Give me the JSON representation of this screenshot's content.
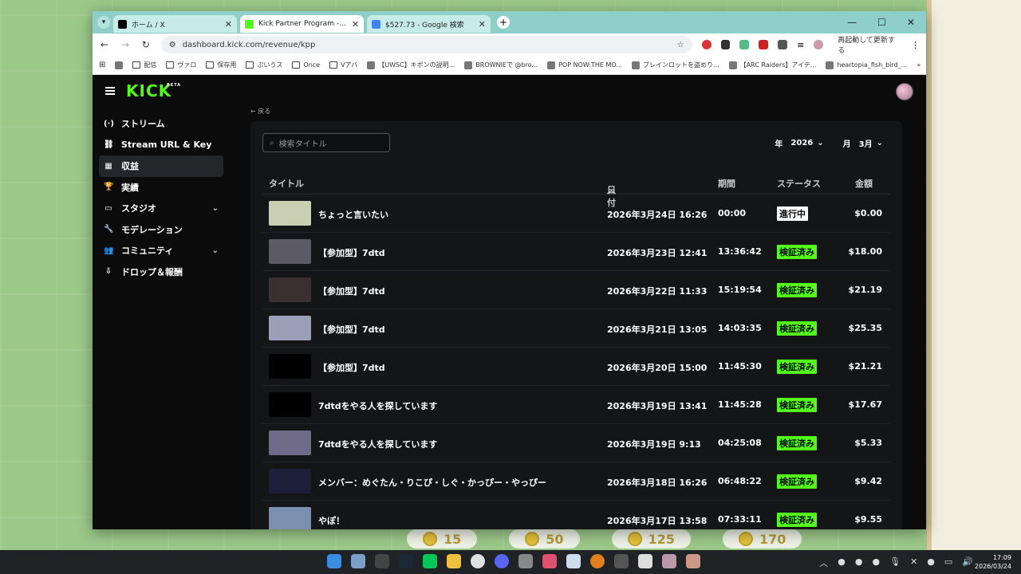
{
  "browser": {
    "tabs": [
      {
        "label": "ホーム / X",
        "favicon_color": "#000000",
        "active": false
      },
      {
        "label": "Kick Partner Program - Kick Da",
        "favicon_color": "#53fc18",
        "active": true
      },
      {
        "label": "$527.73 - Google 検索",
        "favicon_color": "#4285f4",
        "active": false
      }
    ],
    "url": "dashboard.kick.com/revenue/kpp",
    "relaunch_label": "再起動して更新する",
    "bookmarks": [
      {
        "label": "",
        "type": "app"
      },
      {
        "label": "",
        "type": "fav"
      },
      {
        "label": "配信",
        "type": "folder"
      },
      {
        "label": "ヴァロ",
        "type": "folder"
      },
      {
        "label": "保存用",
        "type": "folder"
      },
      {
        "label": "ぷいうス",
        "type": "folder"
      },
      {
        "label": "Once",
        "type": "folder"
      },
      {
        "label": "Vアバ",
        "type": "folder"
      },
      {
        "label": "【UWSC】キボンの説明...",
        "type": "fav"
      },
      {
        "label": "BROWNIEで @bro...",
        "type": "fav"
      },
      {
        "label": "POP NOW:THE MO...",
        "type": "fav"
      },
      {
        "label": "ブレインロットを盗めり...",
        "type": "fav"
      },
      {
        "label": "【ARC Raiders】アイテ...",
        "type": "fav"
      },
      {
        "label": "heartopia_fish_bird_...",
        "type": "fav"
      }
    ]
  },
  "kick": {
    "logo": "KICK",
    "logo_badge": "BETA",
    "breadcrumb": "← 戻る",
    "sidebar": [
      {
        "label": "ストリーム",
        "icon": "broadcast-icon",
        "glyph": "(·)",
        "active": false,
        "expand": false
      },
      {
        "label": "Stream URL & Key",
        "icon": "link-icon",
        "glyph": "⛓",
        "active": false,
        "expand": false
      },
      {
        "label": "収益",
        "icon": "revenue-icon",
        "glyph": "▦",
        "active": true,
        "expand": false
      },
      {
        "label": "実績",
        "icon": "trophy-icon",
        "glyph": "🏆",
        "active": false,
        "expand": false
      },
      {
        "label": "スタジオ",
        "icon": "studio-icon",
        "glyph": "▭",
        "active": false,
        "expand": true
      },
      {
        "label": "モデレーション",
        "icon": "wrench-icon",
        "glyph": "🔧",
        "active": false,
        "expand": false
      },
      {
        "label": "コミュニティ",
        "icon": "community-icon",
        "glyph": "👥",
        "active": false,
        "expand": true
      },
      {
        "label": "ドロップ＆報酬",
        "icon": "drops-icon",
        "glyph": "⇩",
        "active": false,
        "expand": false
      }
    ],
    "search_placeholder": "検索タイトル",
    "filters": {
      "year_label": "年",
      "year_value": "2026",
      "month_label": "月",
      "month_value": "3月"
    },
    "columns": {
      "title": "タイトル",
      "date": "日付",
      "duration": "期間",
      "status": "ステータス",
      "amount": "金額"
    },
    "rows": [
      {
        "title": "ちょっと言いたい",
        "date": "2026年3月24日 16:26",
        "duration": "00:00",
        "status": "進行中",
        "status_type": "live",
        "amount": "$0.00",
        "thumb": "#c9cfb0"
      },
      {
        "title": "【参加型】7dtd",
        "date": "2026年3月23日 12:41",
        "duration": "13:36:42",
        "status": "検証済み",
        "status_type": "ok",
        "amount": "$18.00",
        "thumb": "#5b5a66"
      },
      {
        "title": "【参加型】7dtd",
        "date": "2026年3月22日 11:33",
        "duration": "15:19:54",
        "status": "検証済み",
        "status_type": "ok",
        "amount": "$21.19",
        "thumb": "#3a3030"
      },
      {
        "title": "【参加型】7dtd",
        "date": "2026年3月21日 13:05",
        "duration": "14:03:35",
        "status": "検証済み",
        "status_type": "ok",
        "amount": "$25.35",
        "thumb": "#9aa0b8"
      },
      {
        "title": "【参加型】7dtd",
        "date": "2026年3月20日 15:00",
        "duration": "11:45:30",
        "status": "検証済み",
        "status_type": "ok",
        "amount": "$21.21",
        "thumb": "#000000"
      },
      {
        "title": "7dtdをやる人を探しています",
        "date": "2026年3月19日 13:41",
        "duration": "11:45:28",
        "status": "検証済み",
        "status_type": "ok",
        "amount": "$17.67",
        "thumb": "#000000"
      },
      {
        "title": "7dtdをやる人を探しています",
        "date": "2026年3月19日 9:13",
        "duration": "04:25:08",
        "status": "検証済み",
        "status_type": "ok",
        "amount": "$5.33",
        "thumb": "#6e6a88"
      },
      {
        "title": "メンバー：めぐたん・りこぴ・しぐ・かっぴー・やっぴー",
        "date": "2026年3月18日 16:26",
        "duration": "06:48:22",
        "status": "検証済み",
        "status_type": "ok",
        "amount": "$9.42",
        "thumb": "#1c1e3a"
      },
      {
        "title": "やぽ！",
        "date": "2026年3月17日 13:58",
        "duration": "07:33:11",
        "status": "検証済み",
        "status_type": "ok",
        "amount": "$9.55",
        "thumb": "#7d8fb0"
      }
    ]
  },
  "desktop": {
    "coins": [
      "15",
      "50",
      "125",
      "170"
    ]
  },
  "taskbar": {
    "time": "17:09",
    "date": "2026/03/24"
  }
}
